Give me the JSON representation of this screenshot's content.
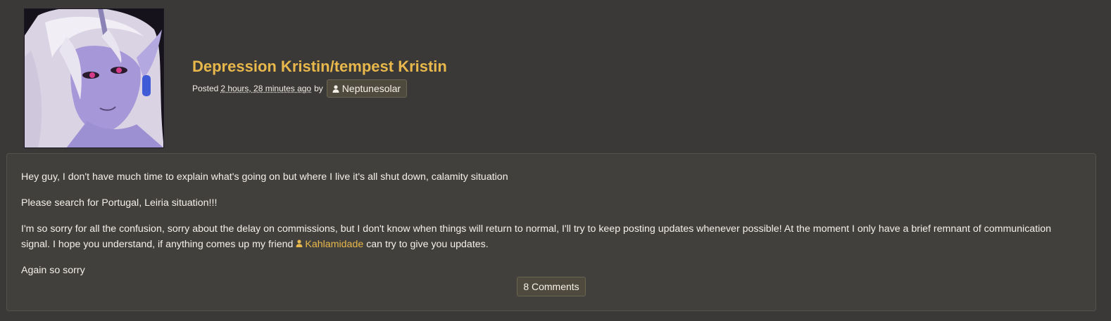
{
  "post": {
    "title": "Depression Kristin/tempest Kristin",
    "posted_label": "Posted",
    "time_ago": "2 hours, 28 minutes ago",
    "by_label": "by",
    "author": "Neptunesolar",
    "avatar_icon": "character-portrait-avatar"
  },
  "body": {
    "paragraph_1": "Hey guy, I don't have much time to explain what's going on but where I live it's all shut down, calamity situation",
    "paragraph_2": "Please search for Portugal, Leiria situation!!!",
    "paragraph_3_before": "I'm so sorry for all the confusion, sorry about the delay on commissions, but I don't know when things will return to normal, I'll try to keep posting updates whenever possible! At the moment I only have a brief remnant of communication signal. I hope you understand, if anything comes up my friend",
    "friend_name": "Kahlamidade",
    "paragraph_3_after": "can try to give you updates.",
    "paragraph_4": "Again so sorry"
  },
  "comments": {
    "label": "8 Comments"
  },
  "colors": {
    "background": "#3b3937",
    "panel": "#42403d",
    "accent": "#e8b84c",
    "chip": "#4f4a3e"
  },
  "icons": {
    "user": "user-icon"
  }
}
